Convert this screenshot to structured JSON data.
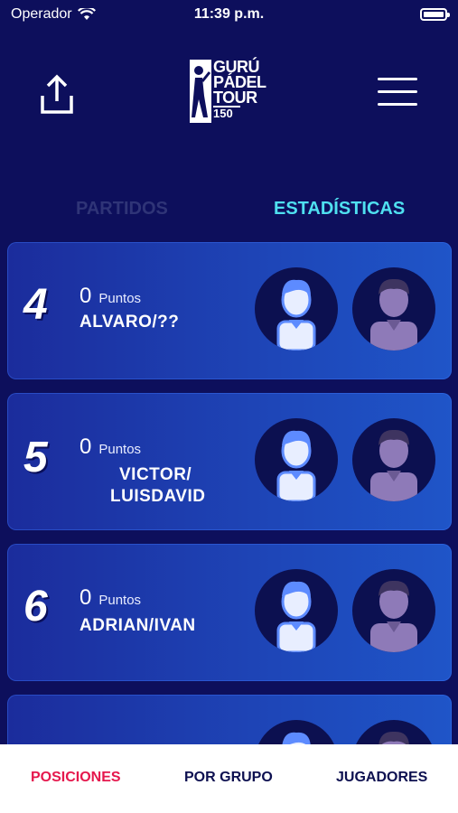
{
  "status_bar": {
    "carrier": "Operador",
    "time": "11:39 p.m."
  },
  "header": {
    "logo_lines": [
      "GURÚ",
      "PÁDEL",
      "TOUR"
    ],
    "logo_number": "150"
  },
  "tabs": {
    "partidos": "PARTIDOS",
    "estadisticas": "ESTADÍSTICAS",
    "active": "estadisticas"
  },
  "standings": [
    {
      "rank": "4",
      "points": "0",
      "points_label": "Puntos",
      "team": "ALVARO/??"
    },
    {
      "rank": "5",
      "points": "0",
      "points_label": "Puntos",
      "team_line1": "VICTOR/",
      "team_line2": "LUISDAVID"
    },
    {
      "rank": "6",
      "points": "0",
      "points_label": "Puntos",
      "team": "ADRIAN/IVAN"
    }
  ],
  "bottom_nav": {
    "posiciones": "POSICIONES",
    "por_grupo": "POR GRUPO",
    "jugadores": "JUGADORES",
    "active": "posiciones"
  },
  "colors": {
    "background": "#0d0f5c",
    "tab_active": "#4fe0f0",
    "tab_inactive": "#2f3477",
    "nav_active": "#e5184d"
  },
  "icons": {
    "share": "share-icon",
    "menu": "hamburger-menu-icon",
    "avatar_player1": "avatar-outline-icon",
    "avatar_player2": "avatar-silhouette-icon"
  }
}
